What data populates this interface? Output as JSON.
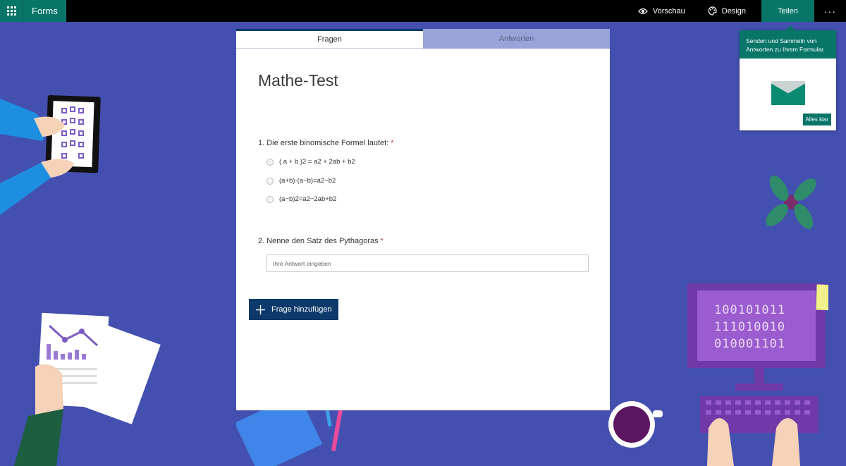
{
  "topbar": {
    "app_name": "Forms",
    "preview_label": "Vorschau",
    "design_label": "Design",
    "share_label": "Teilen",
    "more_label": "···"
  },
  "tabs": [
    {
      "label": "Fragen",
      "active": true
    },
    {
      "label": "Antworten",
      "active": false
    }
  ],
  "form": {
    "title": "Mathe-Test",
    "questions": [
      {
        "title": "1. Die erste binomische Formel lautet:",
        "required": "*",
        "options": [
          "( a + b )2 = a2 + 2ab + b2",
          "(a+b)·(a−b)=a2−b2",
          "(a−b)2=a2−2ab+b2"
        ]
      },
      {
        "title": "2. Nenne  den Satz des Pythagoras",
        "required": "*",
        "placeholder": "Ihre Antwort eingeben"
      }
    ],
    "add_question_label": "Frage hinzufügen"
  },
  "popover": {
    "text": "Senden und Sammeln von Antworten zu Ihrem Formular.",
    "ok_label": "Alles klar"
  },
  "decor": {
    "binary_lines": [
      "100101011",
      "111010010",
      "010001101"
    ]
  },
  "colors": {
    "background": "#4450b0",
    "accent_teal": "#077568",
    "button_navy": "#0e3a6b",
    "inactive_tab": "#9aa3d9"
  }
}
